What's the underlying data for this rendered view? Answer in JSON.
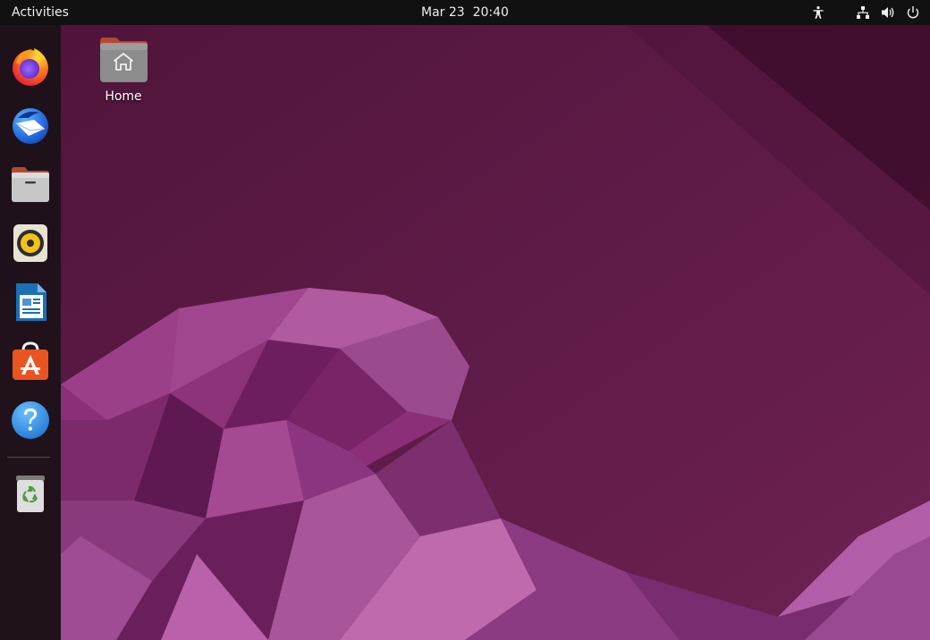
{
  "topbar": {
    "activities_label": "Activities",
    "date": "Mar 23",
    "time": "20:40",
    "indicators": [
      "accessibility-icon",
      "network-wired-icon",
      "volume-icon",
      "power-icon"
    ]
  },
  "dock": {
    "apps": [
      {
        "name": "firefox",
        "icon": "firefox-icon"
      },
      {
        "name": "thunderbird",
        "icon": "thunderbird-icon"
      },
      {
        "name": "files",
        "icon": "files-icon"
      },
      {
        "name": "rhythmbox",
        "icon": "rhythmbox-icon"
      },
      {
        "name": "libreoffice-writer",
        "icon": "writer-icon"
      },
      {
        "name": "software",
        "icon": "software-icon"
      },
      {
        "name": "help",
        "icon": "help-icon"
      }
    ],
    "trash": {
      "icon": "trash-icon"
    }
  },
  "desktop": {
    "icons": [
      {
        "label": "Home",
        "icon": "home-folder-icon"
      }
    ]
  },
  "colors": {
    "topbar_bg": "#111111",
    "dock_bg": "#1b1118",
    "wallpaper_base": "#5a1a45",
    "wallpaper_accent": "#9a3b8a",
    "accent_orange": "#e95420"
  }
}
